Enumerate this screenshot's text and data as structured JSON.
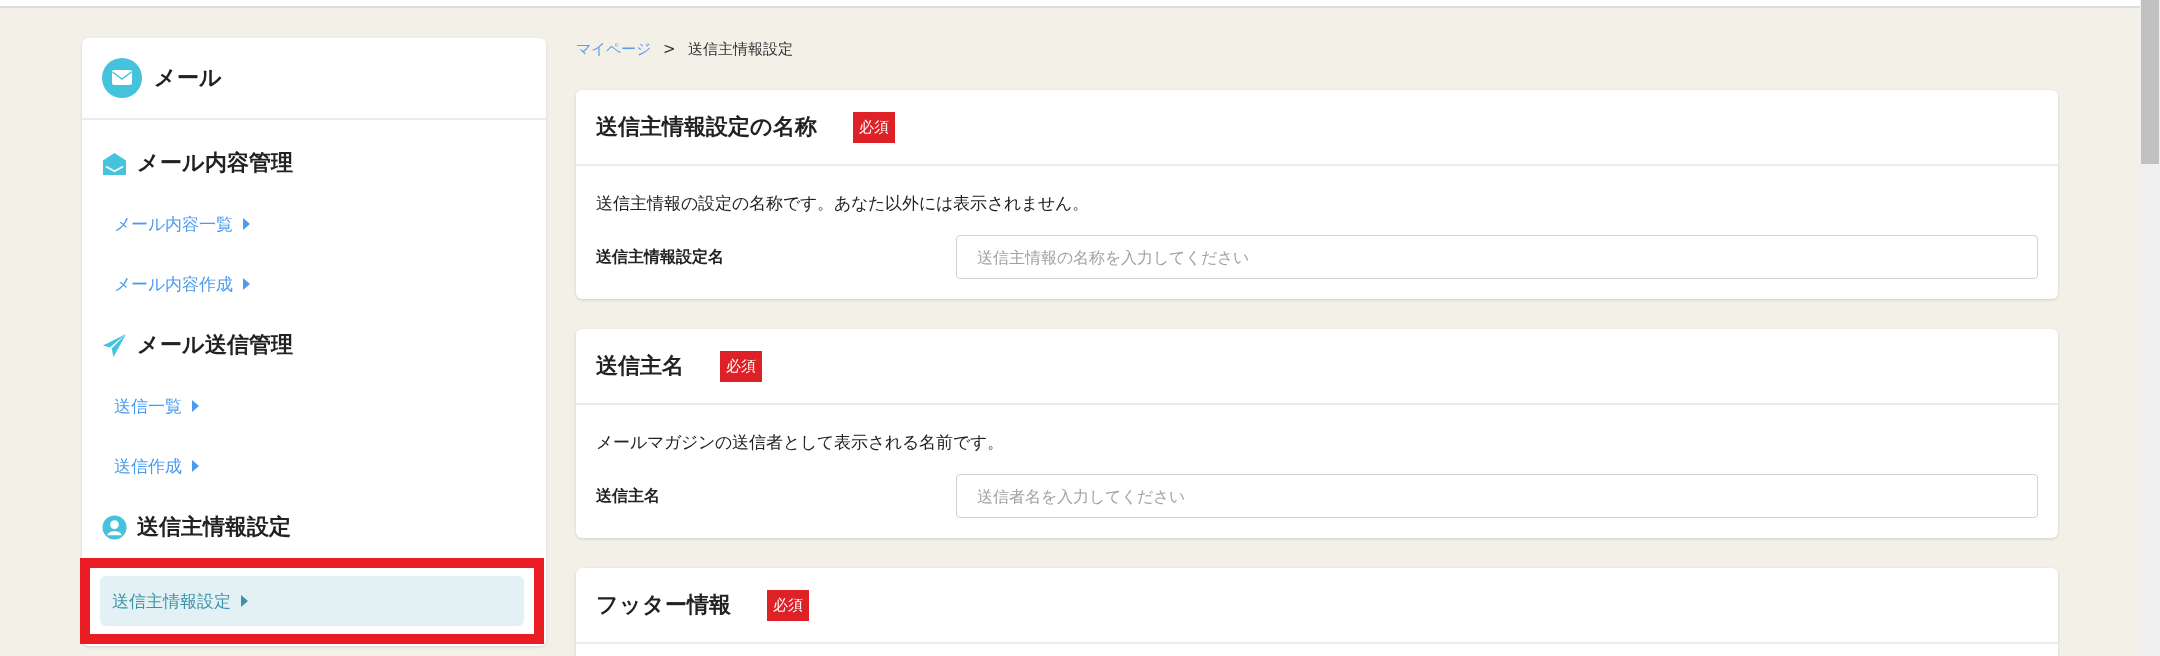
{
  "sidebar": {
    "title": "メール",
    "sections": [
      {
        "kind": "envelope-open",
        "title": "メール内容管理",
        "items": [
          {
            "label": "メール内容一覧",
            "selected": false
          },
          {
            "label": "メール内容作成",
            "selected": false
          }
        ]
      },
      {
        "kind": "plane",
        "title": "メール送信管理",
        "items": [
          {
            "label": "送信一覧",
            "selected": false
          },
          {
            "label": "送信作成",
            "selected": false
          }
        ]
      },
      {
        "kind": "user",
        "title": "送信主情報設定",
        "items": [
          {
            "label": "送信主情報設定",
            "selected": true,
            "highlighted": true
          }
        ]
      }
    ]
  },
  "breadcrumb": [
    {
      "label": "マイページ",
      "kind": "link"
    },
    {
      "label": ">",
      "kind": "separator"
    },
    {
      "label": "送信主情報設定",
      "kind": "current"
    }
  ],
  "cards": [
    {
      "title": "送信主情報設定の名称",
      "badge": "必須",
      "description": "送信主情報の設定の名称です。あなた以外には表示されません。",
      "field_label": "送信主情報設定名",
      "placeholder": "送信主情報の名称を入力してください"
    },
    {
      "title": "送信主名",
      "badge": "必須",
      "description": "メールマガジンの送信者として表示される名前です。",
      "field_label": "送信主名",
      "placeholder": "送信者名を入力してください"
    },
    {
      "title": "フッター情報",
      "badge": "必須"
    }
  ]
}
